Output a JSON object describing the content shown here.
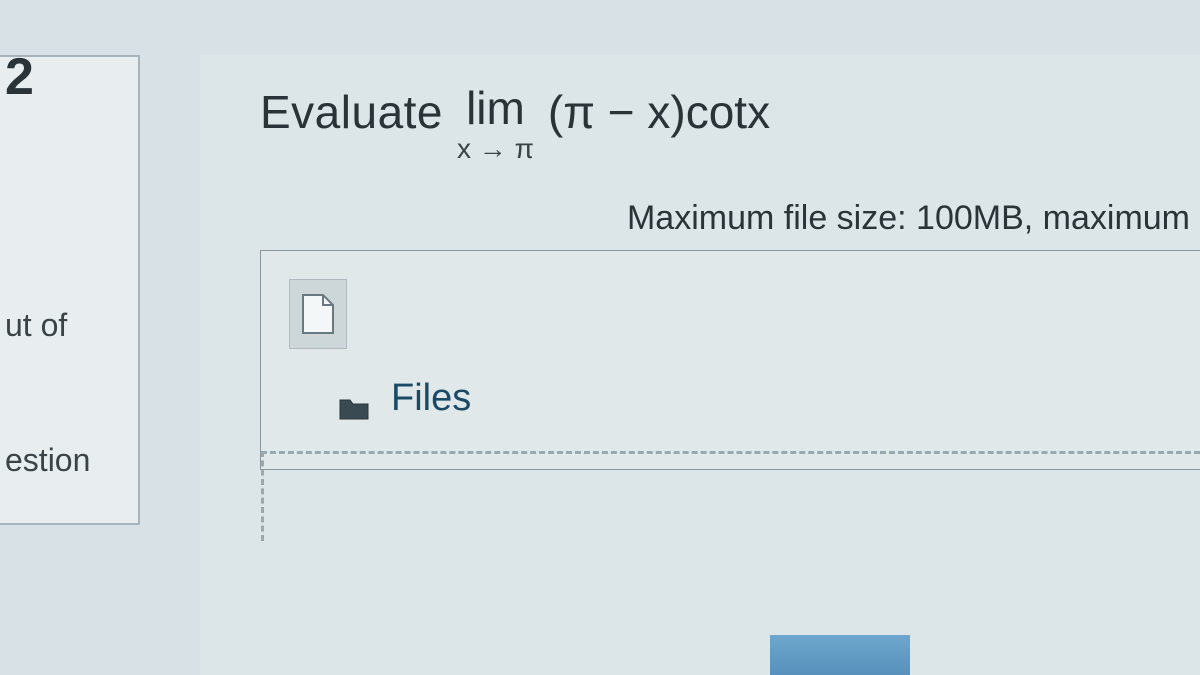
{
  "sidebar": {
    "questionNumber": "2",
    "outOfFragment": "ut of",
    "questionFragment": "estion"
  },
  "prompt": {
    "evaluate": "Evaluate",
    "lim": "lim",
    "approach": "x → π",
    "expression": "(π − x)cotx"
  },
  "upload": {
    "hint": "Maximum file size: 100MB, maximum",
    "filesLabel": "Files"
  }
}
